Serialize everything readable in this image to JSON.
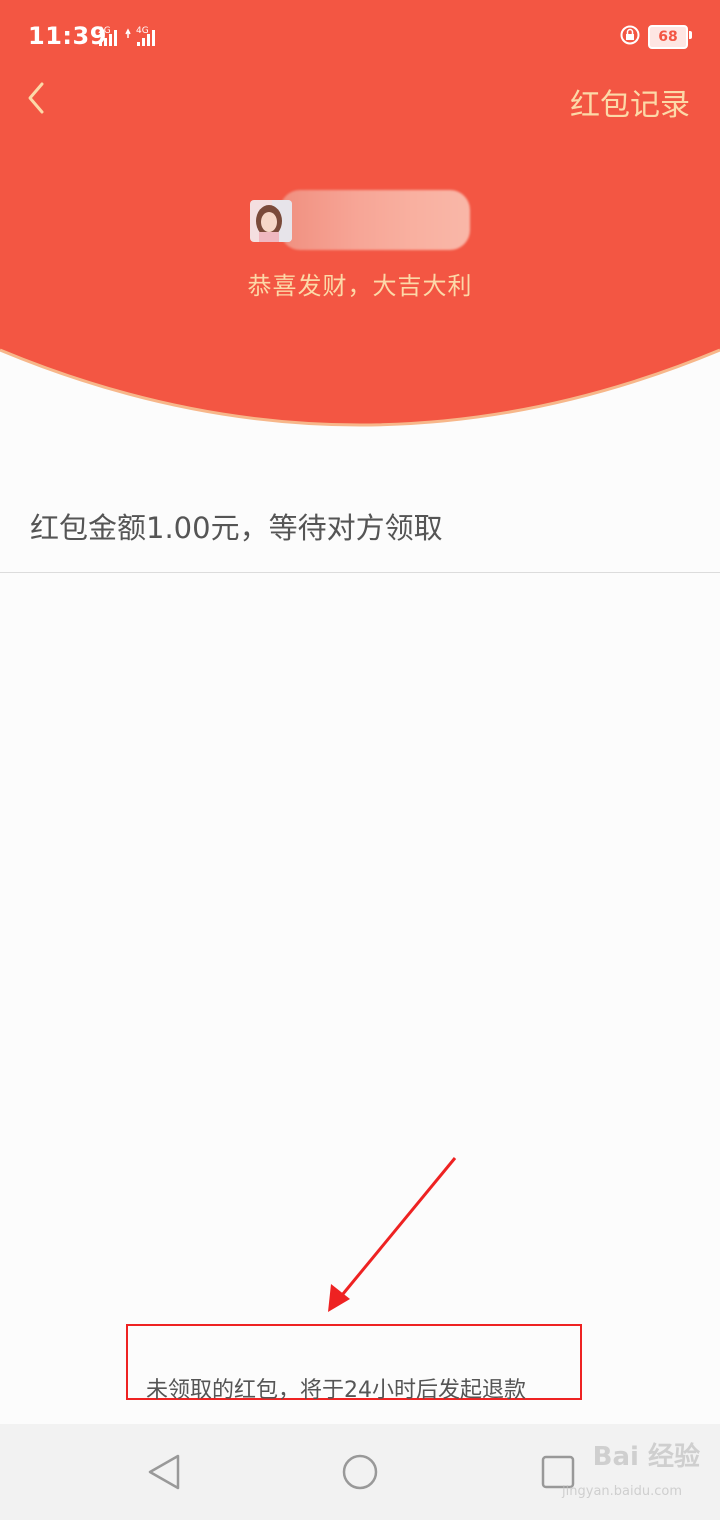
{
  "status": {
    "time": "11:39",
    "sim1": "2G",
    "sim2": "4G",
    "battery": "68"
  },
  "header": {
    "record_label": "红包记录",
    "blessing": "恭喜发财，大吉大利"
  },
  "main": {
    "amount_status": "红包金额1.00元，等待对方领取"
  },
  "footer": {
    "refund_note": "未领取的红包，将于24小时后发起退款"
  },
  "watermark": {
    "brand": "Bai 经验",
    "url": "jingyan.baidu.com"
  },
  "colors": {
    "header_red": "#f35643",
    "gold": "#fcd9a8",
    "annotation_red": "#ee2222"
  }
}
